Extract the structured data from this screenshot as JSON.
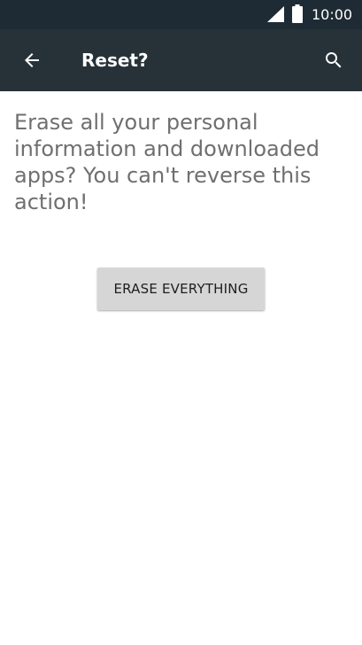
{
  "status_bar": {
    "time": "10:00",
    "icons": [
      "signal-icon",
      "battery-icon"
    ]
  },
  "app_bar": {
    "title": "Reset?",
    "back_icon": "back-arrow-icon",
    "search_icon": "search-icon"
  },
  "content": {
    "message": "Erase all your personal information and downloaded apps? You can't reverse this action!",
    "erase_button_label": "ERASE EVERYTHING"
  },
  "colors": {
    "status_bar": "#1e2b34",
    "app_bar": "#263238",
    "message_text": "#6f6f6f",
    "button_bg": "#d6d6d6"
  }
}
